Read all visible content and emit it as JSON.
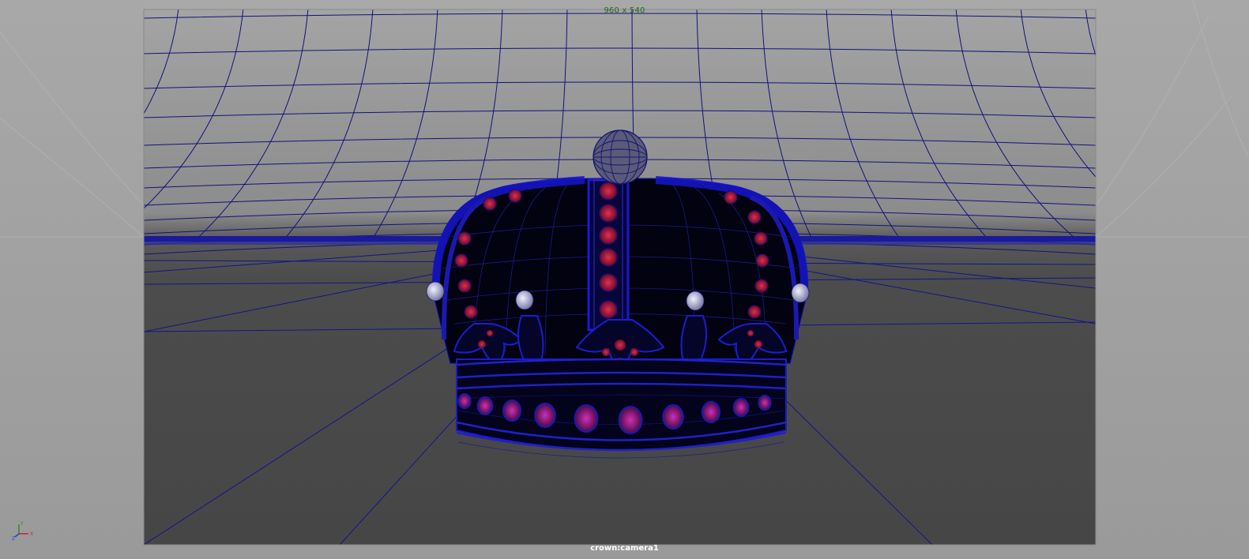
{
  "viewport": {
    "resolution_gate_label": "960 x 540",
    "camera_name": "crown:camera1"
  },
  "axis_indicator": {
    "icon": "view-axis-icon",
    "y_label": "Y",
    "x_label": "X",
    "z_label": "Z",
    "y_color": "#2e8b2e",
    "x_color": "#cc2222",
    "z_color": "#2244cc"
  },
  "scene": {
    "object": "crown",
    "wireframe_color": "#0a0a8a",
    "background_color": "#999999",
    "gate_top_color": "#a3a3a3",
    "floor_color": "#4a4a4a",
    "gem_color_red": "#c81e3c",
    "gem_color_magenta": "#b0208f",
    "pearl_color": "#d8d8f0"
  }
}
